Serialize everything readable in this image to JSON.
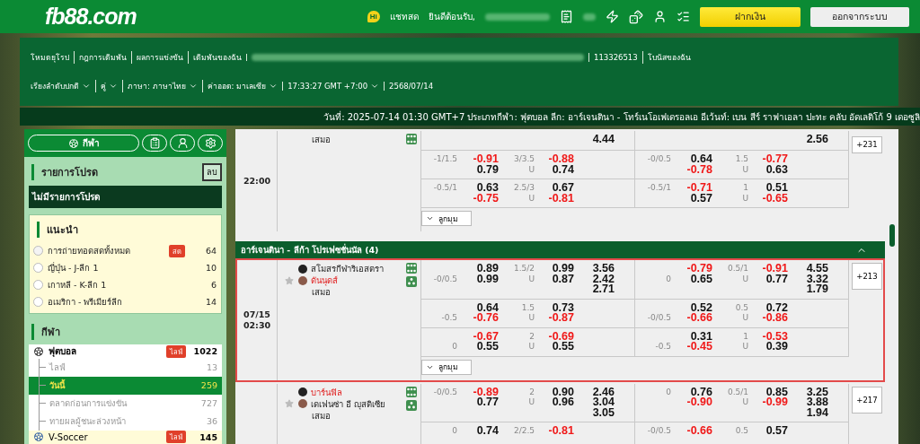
{
  "header": {
    "logo": "fb88.com",
    "chat_badge": "Hi",
    "chat": "แชทสด",
    "welcome": "ยินดีต้อนรับ,",
    "deposit": "ฝากเงิน",
    "logout": "ออกจากระบบ"
  },
  "nav": {
    "links": [
      "โหมดยุโรป",
      "กฎการเดิมพัน",
      "ผลการแข่งขัน",
      "เดิมพันของฉัน"
    ],
    "account_id": "113326513",
    "bonus": "โบนัสของฉัน",
    "settings": [
      {
        "label": "เรียงลำดับปกติ",
        "dropdown": true
      },
      {
        "label": "คู่",
        "dropdown": true
      },
      {
        "label": "ภาษา: ภาษาไทย",
        "dropdown": true
      },
      {
        "label": "ค่าออด: มาเลเซีย",
        "dropdown": true
      },
      {
        "label": "17:33:27 GMT +7:00",
        "dropdown": true
      },
      {
        "label": "2568/07/14",
        "dropdown": false
      }
    ]
  },
  "ticker": "วันที่: 2025-07-14 01:30 GMT+7 ประเภทกีฬา: ฟุตบอล ลีก: อาร์เจนตินา - โทร์เนโอเฟเดรอลเอ อีเว้นท์: เบน สีร์ ราฟาเอลา ปะทะ คลับ อัดเลติโก้ 9 เดอซูลิ",
  "sidebar": {
    "sports_button": "กีฬา",
    "favorites": {
      "title": "รายการโปรด",
      "clear": "ลบ",
      "empty": "ไม่มีรายการโปรด"
    },
    "recommended": {
      "title": "แนะนำ",
      "items": [
        {
          "name": "การถ่ายทอดสดทั้งหมด",
          "badge": "สด",
          "count": "64"
        },
        {
          "name": "ญี่ปุ่น - J-ลีก 1",
          "count": "10"
        },
        {
          "name": "เกาหลี - K-ลีก 1",
          "count": "6"
        },
        {
          "name": "อเมริกา - พรีเมียร์ลีก",
          "count": "14"
        }
      ]
    },
    "sports": {
      "title": "กีฬา",
      "items": [
        {
          "name": "ฟุตบอล",
          "badge": "ไลฟ์",
          "count": "1022",
          "expanded": true,
          "children": [
            {
              "name": "ไลฟ์",
              "count": "13",
              "selected": false
            },
            {
              "name": "วันนี้",
              "count": "259",
              "selected": true
            },
            {
              "name": "ตลาดก่อนการแข่งขัน",
              "count": "727",
              "selected": false
            },
            {
              "name": "ทายผลผู้ชนะล่วงหน้า",
              "count": "36",
              "selected": false
            }
          ]
        },
        {
          "name": "V-Soccer",
          "badge": "ไลฟ์",
          "count": "145",
          "expanded": false
        }
      ]
    }
  },
  "events": [
    {
      "kind": "match",
      "time": "22:00",
      "highlighted": false,
      "draw": "เสมอ",
      "more": "+231",
      "corners": "ลูกมุม",
      "rows": [
        {
          "market_1": {
            "x12": [
              "4.44"
            ]
          },
          "market_2": {
            "x12": [
              "2.56"
            ]
          }
        },
        {
          "market_1": {
            "hdp": "-1/1.5",
            "line_on_away": false,
            "hdp_odds": [
              {
                "value": "-0.91",
                "negative": true
              },
              {
                "value": "0.79",
                "negative": false
              }
            ],
            "ou": "3/3.5",
            "ou_under": "U",
            "ou_odds": [
              {
                "value": "-0.88",
                "negative": true
              },
              {
                "value": "0.74",
                "negative": false
              }
            ]
          },
          "market_2": {
            "hdp": "-0/0.5",
            "line_on_away": false,
            "hdp_odds": [
              {
                "value": "0.64",
                "negative": false
              },
              {
                "value": "-0.78",
                "negative": true
              }
            ],
            "ou": "1.5",
            "ou_under": "U",
            "ou_odds": [
              {
                "value": "-0.77",
                "negative": true
              },
              {
                "value": "0.63",
                "negative": false
              }
            ]
          }
        },
        {
          "market_1": {
            "hdp": "-0.5/1",
            "line_on_away": false,
            "hdp_odds": [
              {
                "value": "0.63",
                "negative": false
              },
              {
                "value": "-0.75",
                "negative": true
              }
            ],
            "ou": "2.5/3",
            "ou_under": "U",
            "ou_odds": [
              {
                "value": "0.67",
                "negative": false
              },
              {
                "value": "-0.81",
                "negative": true
              }
            ]
          },
          "market_2": {
            "hdp": "-0.5/1",
            "line_on_away": false,
            "hdp_odds": [
              {
                "value": "-0.71",
                "negative": true
              },
              {
                "value": "0.57",
                "negative": false
              }
            ],
            "ou": "1",
            "ou_under": "U",
            "ou_odds": [
              {
                "value": "0.51",
                "negative": false
              },
              {
                "value": "-0.65",
                "negative": true
              }
            ]
          }
        }
      ]
    },
    {
      "kind": "league",
      "name": "อาร์เจนตินา - ลีก้า โปรเฟซชั่นนัล (4)",
      "expanded": true
    },
    {
      "kind": "match",
      "date": "07/15",
      "time": "02:30",
      "highlighted": true,
      "teams": [
        {
          "name": "สโมสรกีฬาริเอสตรา",
          "favorite": false
        },
        {
          "name": "ดันนุดส์",
          "favorite": true
        }
      ],
      "draw": "เสมอ",
      "more": "+213",
      "corners": "ลูกมุม",
      "rows": [
        {
          "market_1": {
            "hdp": "-0/0.5",
            "line_on_away": true,
            "hdp_odds": [
              {
                "value": "0.89",
                "negative": false
              },
              {
                "value": "0.99",
                "negative": false
              }
            ],
            "ou": "1.5/2",
            "ou_under": "U",
            "ou_odds": [
              {
                "value": "0.99",
                "negative": false
              },
              {
                "value": "0.87",
                "negative": false
              }
            ],
            "x12": [
              "3.56",
              "2.42",
              "2.71"
            ]
          },
          "market_2": {
            "hdp": "0",
            "line_on_away": true,
            "hdp_odds": [
              {
                "value": "-0.79",
                "negative": true
              },
              {
                "value": "0.65",
                "negative": false
              }
            ],
            "ou": "0.5/1",
            "ou_under": "U",
            "ou_odds": [
              {
                "value": "-0.91",
                "negative": true
              },
              {
                "value": "0.77",
                "negative": false
              }
            ],
            "x12": [
              "4.55",
              "3.32",
              "1.79"
            ]
          }
        },
        {
          "market_1": {
            "hdp": "-0.5",
            "line_on_away": true,
            "hdp_odds": [
              {
                "value": "0.64",
                "negative": false
              },
              {
                "value": "-0.76",
                "negative": true
              }
            ],
            "ou": "1.5",
            "ou_under": "U",
            "ou_odds": [
              {
                "value": "0.73",
                "negative": false
              },
              {
                "value": "-0.87",
                "negative": true
              }
            ]
          },
          "market_2": {
            "hdp": "-0/0.5",
            "line_on_away": true,
            "hdp_odds": [
              {
                "value": "0.52",
                "negative": false
              },
              {
                "value": "-0.66",
                "negative": true
              }
            ],
            "ou": "0.5",
            "ou_under": "U",
            "ou_odds": [
              {
                "value": "0.72",
                "negative": false
              },
              {
                "value": "-0.86",
                "negative": true
              }
            ]
          }
        },
        {
          "market_1": {
            "hdp": "0",
            "line_on_away": true,
            "hdp_odds": [
              {
                "value": "-0.67",
                "negative": true
              },
              {
                "value": "0.55",
                "negative": false
              }
            ],
            "ou": "2",
            "ou_under": "U",
            "ou_odds": [
              {
                "value": "-0.69",
                "negative": true
              },
              {
                "value": "0.55",
                "negative": false
              }
            ]
          },
          "market_2": {
            "hdp": "-0.5",
            "line_on_away": true,
            "hdp_odds": [
              {
                "value": "0.31",
                "negative": false
              },
              {
                "value": "-0.45",
                "negative": true
              }
            ],
            "ou": "1",
            "ou_under": "U",
            "ou_odds": [
              {
                "value": "-0.53",
                "negative": true
              },
              {
                "value": "0.39",
                "negative": false
              }
            ]
          }
        }
      ]
    },
    {
      "kind": "match",
      "highlighted": false,
      "teams": [
        {
          "name": "บาร์นฟิล",
          "favorite": true
        },
        {
          "name": "เดเฟนซ่า อี ญุสติเซีย",
          "favorite": false
        }
      ],
      "draw": "เสมอ",
      "more": "+217",
      "rows": [
        {
          "market_1": {
            "hdp": "-0/0.5",
            "line_on_away": false,
            "hdp_odds": [
              {
                "value": "-0.89",
                "negative": true
              },
              {
                "value": "0.77",
                "negative": false
              }
            ],
            "ou": "2",
            "ou_under": "U",
            "ou_odds": [
              {
                "value": "0.90",
                "negative": false
              },
              {
                "value": "0.96",
                "negative": false
              }
            ],
            "x12": [
              "2.46",
              "3.04",
              "3.05"
            ]
          },
          "market_2": {
            "hdp": "0",
            "line_on_away": false,
            "hdp_odds": [
              {
                "value": "0.76",
                "negative": false
              },
              {
                "value": "-0.90",
                "negative": true
              }
            ],
            "ou": "0.5/1",
            "ou_under": "U",
            "ou_odds": [
              {
                "value": "0.85",
                "negative": false
              },
              {
                "value": "-0.99",
                "negative": true
              }
            ],
            "x12": [
              "3.25",
              "3.88",
              "1.94"
            ]
          }
        },
        {
          "market_1": {
            "hdp": "0",
            "line_on_away": false,
            "hdp_odds": [
              {
                "value": "0.74",
                "negative": false
              }
            ],
            "ou": "2/2.5",
            "ou_odds": [
              {
                "value": "-0.81",
                "negative": true
              }
            ]
          },
          "market_2": {
            "hdp": "-0/0.5",
            "line_on_away": false,
            "hdp_odds": [
              {
                "value": "-0.66",
                "negative": true
              }
            ],
            "ou": "0.5",
            "ou_odds": [
              {
                "value": "0.57",
                "negative": false
              }
            ]
          }
        }
      ]
    }
  ]
}
